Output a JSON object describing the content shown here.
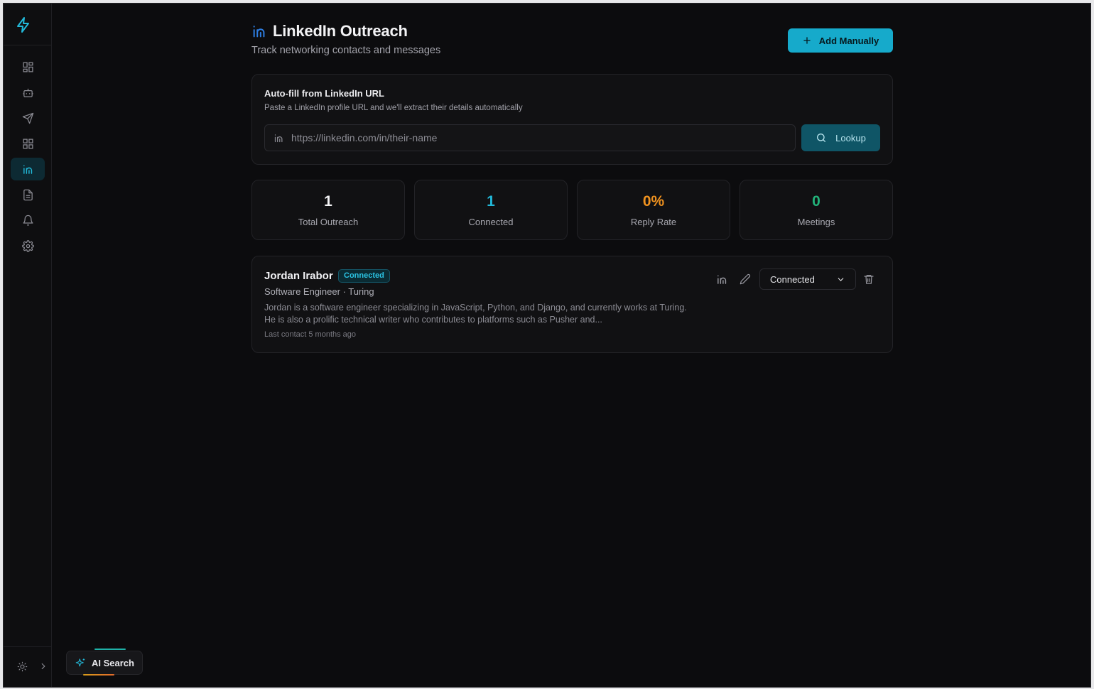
{
  "header": {
    "title": "LinkedIn Outreach",
    "subtitle": "Track networking contacts and messages",
    "add_button": "Add Manually"
  },
  "autofill": {
    "title": "Auto-fill from LinkedIn URL",
    "description": "Paste a LinkedIn profile URL and we'll extract their details automatically",
    "placeholder": "https://linkedin.com/in/their-name",
    "lookup_button": "Lookup"
  },
  "stats": [
    {
      "value": "1",
      "label": "Total Outreach",
      "color": "#f3f3f5"
    },
    {
      "value": "1",
      "label": "Connected",
      "color": "#22b8d8"
    },
    {
      "value": "0%",
      "label": "Reply Rate",
      "color": "#f0921f"
    },
    {
      "value": "0",
      "label": "Meetings",
      "color": "#22b37a"
    }
  ],
  "contacts": [
    {
      "name": "Jordan Irabor",
      "badge": "Connected",
      "role": "Software Engineer · Turing",
      "description": "Jordan is a software engineer specializing in JavaScript, Python, and Django, and currently works at Turing. He is also a prolific technical writer who contributes to platforms such as Pusher and...",
      "last_contact": "Last contact 5 months ago",
      "status": "Connected"
    }
  ],
  "sidebar": {
    "items": [
      {
        "icon": "dashboard-icon"
      },
      {
        "icon": "bot-icon"
      },
      {
        "icon": "send-icon"
      },
      {
        "icon": "grid-icon"
      },
      {
        "icon": "linkedin-icon",
        "active": true
      },
      {
        "icon": "document-icon"
      },
      {
        "icon": "bell-icon"
      },
      {
        "icon": "gear-icon"
      }
    ]
  },
  "ai_search": {
    "label": "AI Search"
  },
  "colors": {
    "accent": "#16aacb",
    "background": "#0c0c0e"
  }
}
